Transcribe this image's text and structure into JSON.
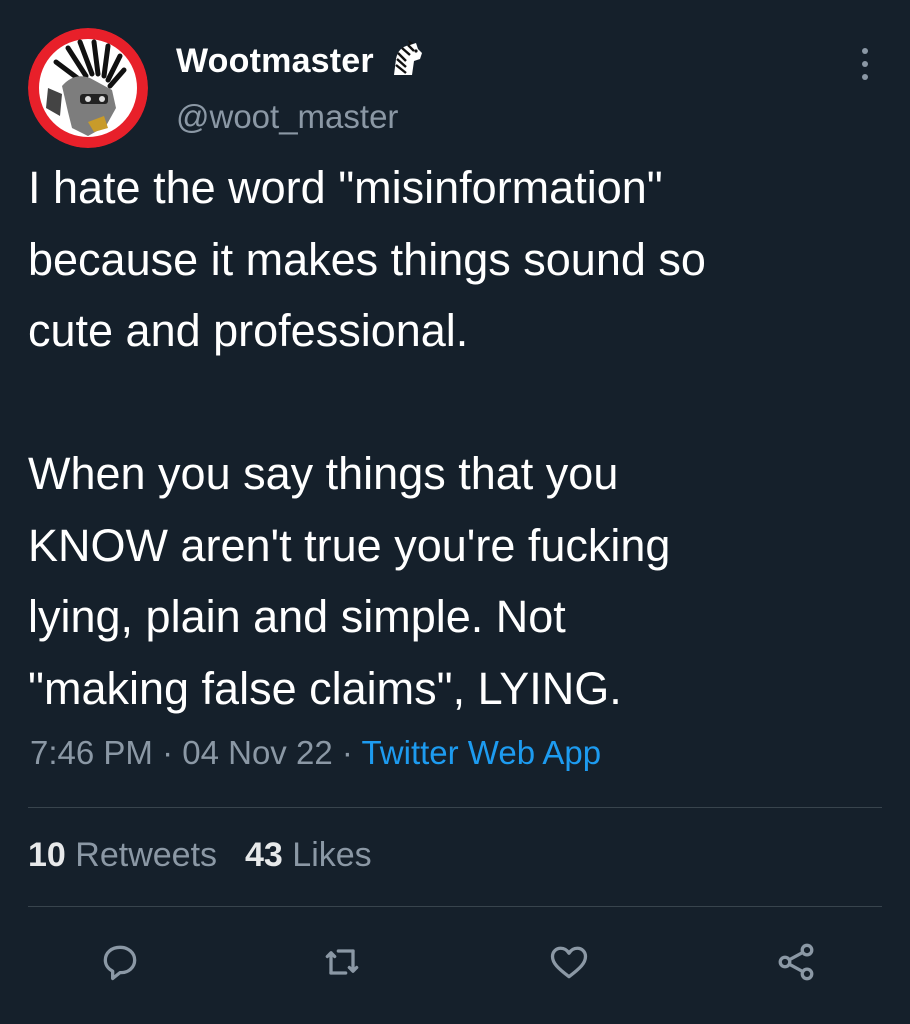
{
  "user": {
    "display_name": "Wootmaster",
    "handle": "@woot_master",
    "badge_icon": "zebra-emoji",
    "avatar_colors": {
      "ring": "#e8202a",
      "bg": "#ffffff"
    }
  },
  "tweet": {
    "text": "I hate the word \"misinformation\"\nbecause it makes things sound so\ncute and professional.\n\nWhen you say things that you\nKNOW aren't true you're fucking\nlying, plain and simple. Not\n\"making false claims\", LYING.",
    "time": "7:46 PM",
    "date": "04 Nov 22",
    "separator": "·",
    "source": "Twitter Web App"
  },
  "stats": {
    "retweets_count": "10",
    "retweets_label": "Retweets",
    "likes_count": "43",
    "likes_label": "Likes"
  },
  "actions": [
    "reply-icon",
    "retweet-icon",
    "like-icon",
    "share-icon"
  ],
  "colors": {
    "background": "#15202b",
    "text": "#ffffff",
    "secondary": "#8b98a5",
    "link": "#1d9bf0",
    "divider": "#38444d"
  }
}
